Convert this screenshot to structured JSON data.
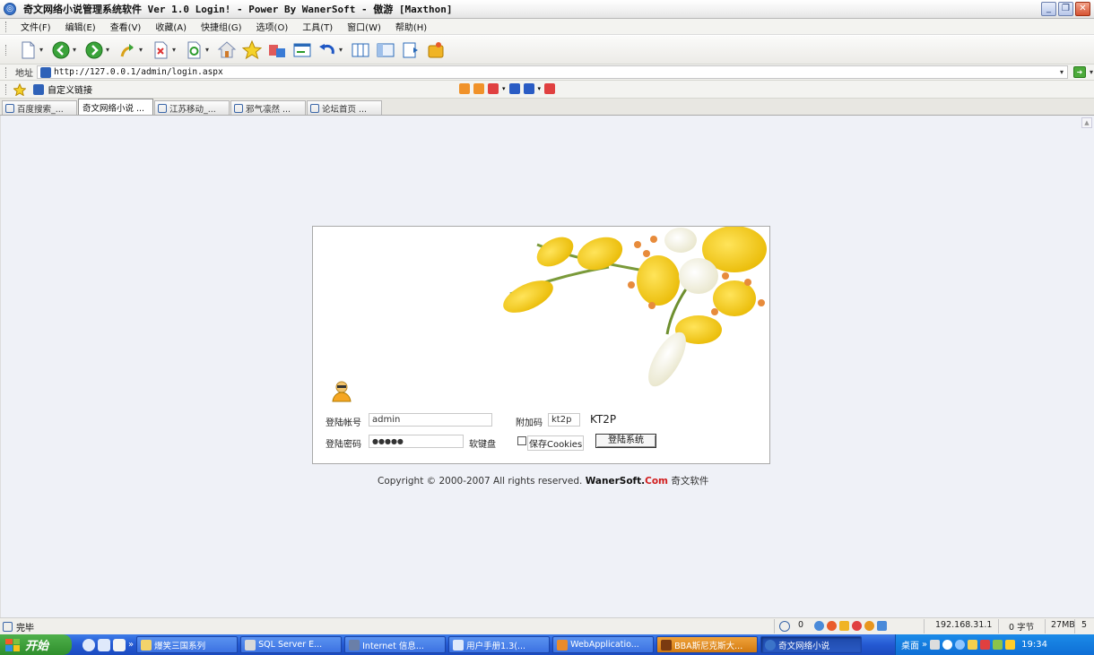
{
  "window": {
    "title": "奇文网络小说管理系统软件 Ver 1.0 Login! - Power By WanerSoft - 傲游 [Maxthon]",
    "controls": [
      "minimize",
      "restore",
      "close"
    ]
  },
  "menu": {
    "items": [
      "文件(F)",
      "编辑(E)",
      "查看(V)",
      "收藏(A)",
      "快捷组(G)",
      "选项(O)",
      "工具(T)",
      "窗口(W)",
      "帮助(H)"
    ]
  },
  "address": {
    "label": "地址",
    "url": "http://127.0.0.1/admin/login.aspx"
  },
  "links": {
    "label": "自定义链接"
  },
  "tabs": [
    {
      "label": "百度搜索_..."
    },
    {
      "label": "奇文网络小说 ..."
    },
    {
      "label": "江苏移动_..."
    },
    {
      "label": "邪气凛然 ..."
    },
    {
      "label": "论坛首页 ..."
    }
  ],
  "login": {
    "account_label": "登陆帐号",
    "account_value": "admin",
    "password_label": "登陆密码",
    "password_value": "●●●●●",
    "captcha_label": "附加码",
    "captcha_value": "kt2p",
    "captcha_image_text": "KT2P",
    "keyboard_label": "软键盘",
    "cookie_label": "保存Cookies",
    "submit_label": "登陆系统"
  },
  "footer": {
    "copyright": "Copyright © 2000-2007 All rights reserved.",
    "brand_a": "WanerSoft.",
    "brand_b": "Com",
    "brand_c": "奇文软件"
  },
  "status": {
    "text": "完毕",
    "popup_count": "0",
    "ip": "192.168.31.1",
    "bytes": "0 字节",
    "memory": "27MB",
    "extra": "5"
  },
  "taskbar": {
    "start_label": "开始",
    "tasks": [
      {
        "label": "爆笑三国系列"
      },
      {
        "label": "SQL Server E..."
      },
      {
        "label": "Internet 信息..."
      },
      {
        "label": "用户手册1.3(..."
      },
      {
        "label": "WebApplicatio..."
      },
      {
        "label": "BBA斯尼克斯大..."
      },
      {
        "label": "奇文网络小说"
      }
    ],
    "desktop_label": "桌面",
    "clock": "19:34"
  }
}
